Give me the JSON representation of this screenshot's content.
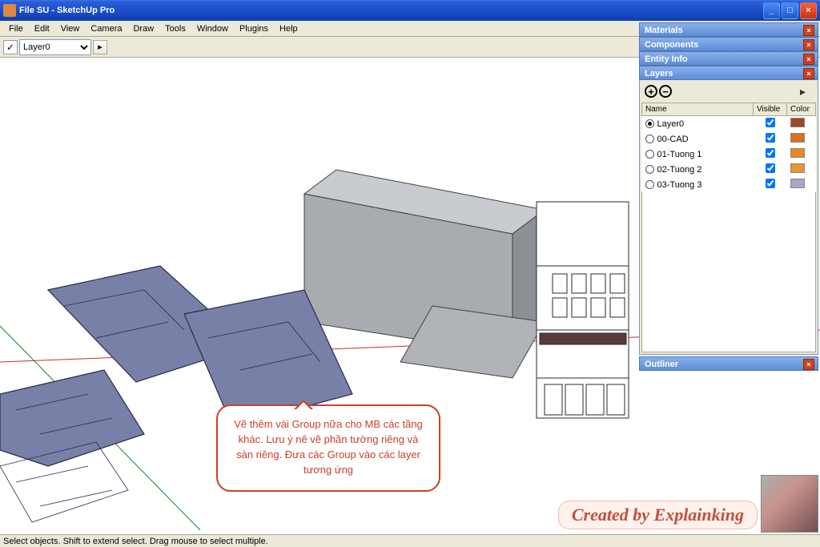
{
  "window": {
    "title": "File SU - SketchUp Pro"
  },
  "menu": [
    "File",
    "Edit",
    "View",
    "Camera",
    "Draw",
    "Tools",
    "Window",
    "Plugins",
    "Help"
  ],
  "layer_toolbar": {
    "current": "Layer0"
  },
  "panels": {
    "materials": "Materials",
    "components": "Components",
    "entity_info": "Entity Info",
    "layers": "Layers",
    "outliner": "Outliner",
    "columns": {
      "name": "Name",
      "visible": "Visible",
      "color": "Color"
    },
    "items": [
      {
        "name": "Layer0",
        "active": true,
        "visible": true,
        "color": "#a04820"
      },
      {
        "name": "00-CAD",
        "active": false,
        "visible": true,
        "color": "#d87020"
      },
      {
        "name": "01-Tuong 1",
        "active": false,
        "visible": true,
        "color": "#e88820"
      },
      {
        "name": "02-Tuong 2",
        "active": false,
        "visible": true,
        "color": "#e89830"
      },
      {
        "name": "03-Tuong 3",
        "active": false,
        "visible": true,
        "color": "#a8a8c8"
      }
    ]
  },
  "annotation": "Vẽ thêm vài Group nữa cho MB các tầng khác. Lưu ý nê vẽ phần tường riêng và sàn riêng. Đưa các Group vào các layer tương ứng",
  "status": "Select objects. Shift to extend select. Drag mouse to select multiple.",
  "watermark": "Created by Explainking"
}
